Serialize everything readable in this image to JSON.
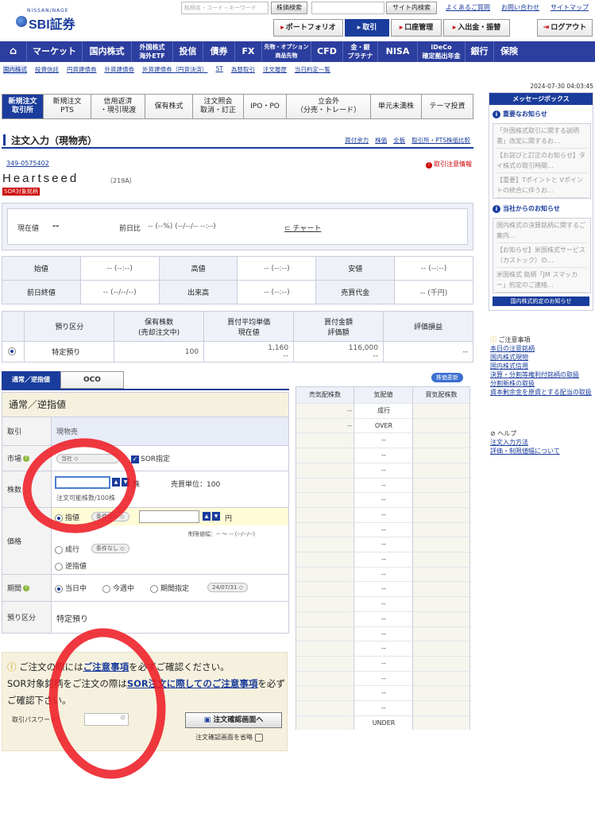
{
  "header": {
    "logo_small": "NISSAN/NAGE",
    "logo_text": "SBI証券",
    "search_placeholder": "銘柄名・コード・キーワード",
    "stock_search_btn": "株価検索",
    "site_search_btn": "サイト内検索",
    "links": [
      "よくあるご質問",
      "お問い合わせ",
      "サイトマップ"
    ],
    "tabs": [
      "ポートフォリオ",
      "取引",
      "口座管理",
      "入出金・振替"
    ],
    "logout": "ログアウト"
  },
  "navbar": [
    "マーケット",
    "国内株式",
    "外国株式\n海外ETF",
    "投信",
    "債券",
    "FX",
    "先物・オプション\n商品先物",
    "CFD",
    "金・銀\nプラチナ",
    "NISA",
    "iDeCo\n確定拠出年金",
    "銀行",
    "保険"
  ],
  "subnav": [
    "国内株式",
    "投資信託",
    "円貨建債券",
    "外貨建債券",
    "外貨建債券（円貨決済）",
    "ST",
    "為替取引",
    "注文履歴",
    "当日約定一覧"
  ],
  "datetime": "2024-07-30 04:03:45",
  "main_tabs": [
    "新規注文\n取引所",
    "新規注文\nPTS",
    "信用返済\n・現引現渡",
    "保有株式",
    "注文照会\n取消・訂正",
    "IPO・PO",
    "立会外\n（分売・トレード）",
    "単元未満株",
    "テーマ投資"
  ],
  "page_title": "注文入力（現物売）",
  "title_links": [
    "買付余力",
    "株価",
    "全板",
    "取引所・PTS株価比較"
  ],
  "account_no": "349-0575402",
  "caution_link": "取引注意情報",
  "stock": {
    "name": "Heartseed",
    "code": "（219A）",
    "sor_badge": "SOR対象銘柄"
  },
  "price": {
    "current_label": "現在値",
    "current_value": "--",
    "change_label": "前日比",
    "change_value": "-- (--%) (--/--/-- --:--)",
    "chart_link": "チャート"
  },
  "quote_table": [
    [
      {
        "l": "始値",
        "v": "-- (--:--)"
      },
      {
        "l": "高値",
        "v": "-- (--:--)"
      },
      {
        "l": "安値",
        "v": "-- (--:--)"
      }
    ],
    [
      {
        "l": "前日終値",
        "v": "-- (--/--/--)"
      },
      {
        "l": "出来高",
        "v": "-- (--:--)"
      },
      {
        "l": "売買代金",
        "v": "-- (千円)"
      }
    ]
  ],
  "holding": {
    "headers": [
      "預り区分",
      "保有株数\n(売却注文中)",
      "買付平均単価\n現在値",
      "買付金額\n評価額",
      "評価損益"
    ],
    "row": {
      "type": "特定預り",
      "shares": "100",
      "avg_price": "1,160",
      "avg_sub": "--",
      "amount": "116,000",
      "amount_sub": "--",
      "pl": "--"
    }
  },
  "order_tabs": [
    "通常／逆指値",
    "OCO"
  ],
  "refresh_btn": "株価更新",
  "form": {
    "header": "通常／逆指値",
    "trade_label": "取引",
    "trade_value": "現物売",
    "market_label": "市場",
    "market_value": "当社",
    "sor_label": "SOR指定",
    "qty_label": "株数",
    "qty_unit": "株",
    "unit_label": "売買単位：100",
    "qty_note": "注文可能株数/100株",
    "price_label": "価格",
    "limit_label": "指値",
    "cond_none": "条件なし",
    "yen": "円",
    "limit_range": "制限値幅：-- 〜 -- (--/--/--)",
    "market_order": "成行",
    "stop_order": "逆指値",
    "period_label": "期間",
    "period_today": "当日中",
    "period_week": "今週中",
    "period_spec": "期間指定",
    "period_date": "24/07/31",
    "account_label": "預り区分",
    "account_value": "特定預り"
  },
  "board": {
    "headers": [
      "売気配株数",
      "気配値",
      "買気配株数"
    ],
    "rows": [
      {
        "sell": "--",
        "price": "成行"
      },
      {
        "sell": "--",
        "price": "OVER"
      },
      {
        "sell": "",
        "price": "--"
      },
      {
        "sell": "",
        "price": "--"
      },
      {
        "sell": "",
        "price": "--"
      },
      {
        "sell": "",
        "price": "--"
      },
      {
        "sell": "",
        "price": "--"
      },
      {
        "sell": "",
        "price": "--"
      },
      {
        "sell": "",
        "price": "--"
      },
      {
        "sell": "",
        "price": "--"
      },
      {
        "sell": "",
        "price": "--"
      },
      {
        "sell": "",
        "price": "--"
      },
      {
        "sell": "",
        "price": "--"
      },
      {
        "sell": "",
        "price": "--"
      },
      {
        "sell": "",
        "price": "--"
      },
      {
        "sell": "",
        "price": "--"
      },
      {
        "sell": "",
        "price": "--"
      },
      {
        "sell": "",
        "price": "--"
      },
      {
        "sell": "",
        "price": "--"
      },
      {
        "sell": "",
        "price": "--"
      },
      {
        "sell": "",
        "price": "--"
      },
      {
        "sell": "",
        "price": "UNDER"
      }
    ]
  },
  "confirm": {
    "msg1": "ご注文の際には",
    "msg1_link": "ご注意事項",
    "msg1b": "を必ずご確認ください。",
    "msg2": "SOR対象銘柄をご注文の際は",
    "msg2_link": "SOR注文に際してのご注意事項",
    "msg2b": "を必ずご確認下さい。",
    "pw_label": "取引パスワード：",
    "confirm_btn": "注文確認画面へ",
    "skip_label": "注文確認画面を省略"
  },
  "sidebar": {
    "title": "メッセージボックス",
    "important": "重要なお知らせ",
    "important_items": [
      "「外国株式取引に関する説明書」改定に関するお...",
      "【お詫びと訂正のお知らせ】タイ株式の取引時間...",
      "【重要】Tポイントと Vポイントの統合に伴うお..."
    ],
    "company": "当社からのお知らせ",
    "company_items": [
      "国内株式の決算銘柄に関するご案内...",
      "【お知らせ】米国株式サービス（カストック）の...",
      "米国株式 銘柄「JM スマッカー」約定のご連絡..."
    ],
    "footer": "国内株式約定のお知らせ",
    "notes_title": "ご注意事項",
    "notes": [
      "本日の注意銘柄",
      "国内株式現物",
      "国内株式信用",
      "決算・分割等権利付銘柄の取扱",
      "分割新株の取扱",
      "資本剰余金を原資とする配当の取扱"
    ],
    "help_title": "ヘルプ",
    "help": [
      "注文入力方法",
      "評価・制限値幅について"
    ]
  }
}
